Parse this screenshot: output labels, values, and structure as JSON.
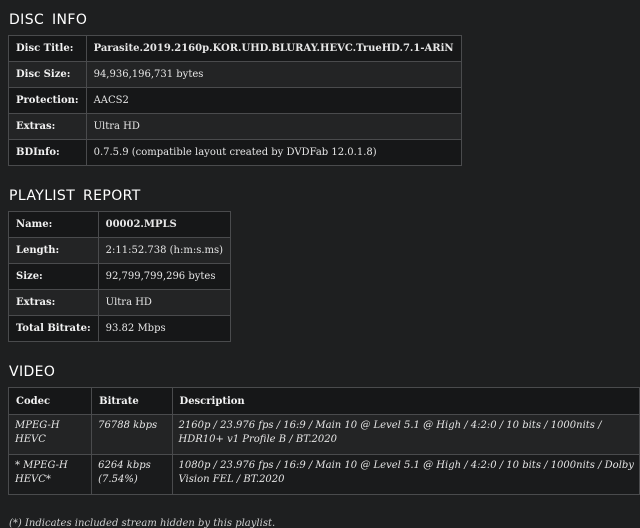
{
  "disc_info": {
    "heading": "DISC INFO",
    "rows": [
      {
        "label": "Disc Title:",
        "value": "Parasite.2019.2160p.KOR.UHD.BLURAY.HEVC.TrueHD.7.1-ARiN"
      },
      {
        "label": "Disc Size:",
        "value": "94,936,196,731 bytes"
      },
      {
        "label": "Protection:",
        "value": "AACS2"
      },
      {
        "label": "Extras:",
        "value": "Ultra HD"
      },
      {
        "label": "BDInfo:",
        "value": "0.7.5.9 (compatible layout created by DVDFab 12.0.1.8)"
      }
    ]
  },
  "playlist_report": {
    "heading": "PLAYLIST REPORT",
    "rows": [
      {
        "label": "Name:",
        "value": "00002.MPLS"
      },
      {
        "label": "Length:",
        "value": "2:11:52.738 (h:m:s.ms)"
      },
      {
        "label": "Size:",
        "value": "92,799,799,296 bytes"
      },
      {
        "label": "Extras:",
        "value": "Ultra HD"
      },
      {
        "label": "Total Bitrate:",
        "value": "93.82 Mbps"
      }
    ]
  },
  "video": {
    "heading": "VIDEO",
    "columns": [
      "Codec",
      "Bitrate",
      "Description"
    ],
    "rows": [
      {
        "codec": "MPEG-H HEVC",
        "bitrate": "76788 kbps",
        "description": "2160p / 23.976 fps / 16:9 / Main 10 @ Level 5.1 @ High / 4:2:0 / 10 bits / 1000nits / HDR10+ v1 Profile B / BT.2020"
      },
      {
        "codec": "* MPEG-H HEVC*",
        "bitrate": "6264 kbps (7.54%)",
        "description": "1080p / 23.976 fps / 16:9 / Main 10 @ Level 5.1 @ High / 4:2:0 / 10 bits / 1000nits / Dolby Vision FEL / BT.2020"
      }
    ],
    "footnote": "(*) Indicates included stream hidden by this playlist."
  }
}
